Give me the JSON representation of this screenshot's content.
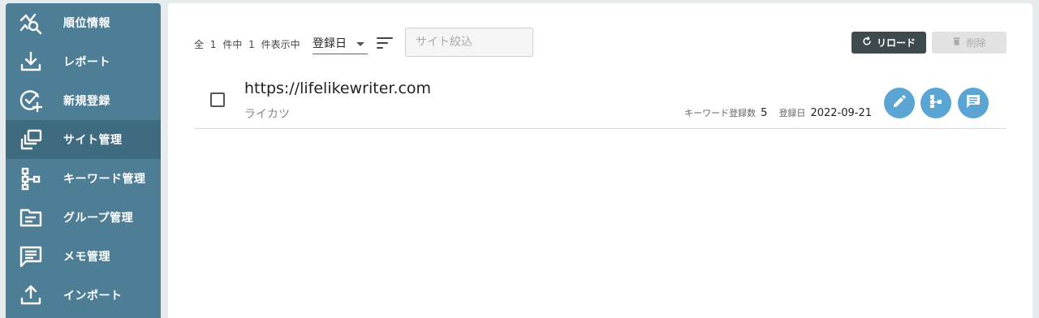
{
  "sidebar": {
    "items": [
      {
        "label": "順位情報",
        "icon": "rank-chart-icon",
        "active": false
      },
      {
        "label": "レポート",
        "icon": "download-icon",
        "active": false
      },
      {
        "label": "新規登録",
        "icon": "check-add-icon",
        "active": false
      },
      {
        "label": "サイト管理",
        "icon": "sites-icon",
        "active": true
      },
      {
        "label": "キーワード管理",
        "icon": "tree-icon",
        "active": false
      },
      {
        "label": "グループ管理",
        "icon": "folder-icon",
        "active": false
      },
      {
        "label": "メモ管理",
        "icon": "memo-icon",
        "active": false
      },
      {
        "label": "インポート",
        "icon": "upload-icon",
        "active": false
      }
    ]
  },
  "toolbar": {
    "total_prefix": "全",
    "total_count": "1",
    "total_suffix": "件中",
    "shown_count": "1",
    "shown_suffix": "件表示中",
    "sort_value": "登録日",
    "filter_placeholder": "サイト絞込",
    "filter_value": "",
    "reload_label": "リロード",
    "delete_label": "削除"
  },
  "sites": [
    {
      "url": "https://lifelikewriter.com",
      "name": "ライカツ",
      "keyword_label": "キーワード登録数",
      "keyword_count": "5",
      "date_label": "登録日",
      "date": "2022-09-21"
    }
  ],
  "colors": {
    "sidebar": "#4d7e95",
    "sidebar_active": "#3e6b80",
    "accent": "#5aa5d3",
    "reload_button": "#3f4a4f"
  }
}
